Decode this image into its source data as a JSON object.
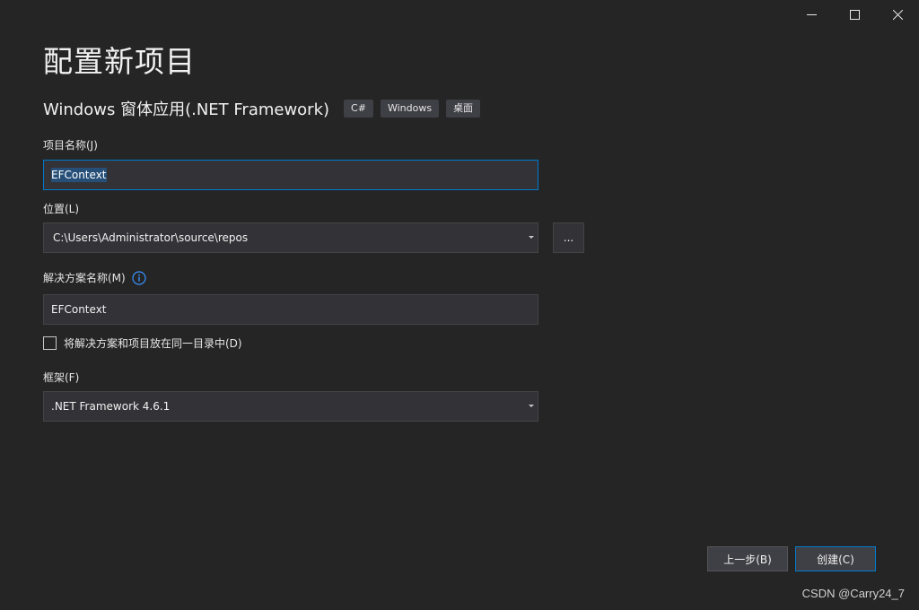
{
  "window": {
    "controls": [
      "minimize",
      "maximize",
      "close"
    ]
  },
  "header": {
    "title": "配置新项目",
    "template_name": "Windows 窗体应用(.NET Framework)",
    "tags": [
      "C#",
      "Windows",
      "桌面"
    ]
  },
  "form": {
    "project_name": {
      "label": "项目名称(J)",
      "value": "EFContext"
    },
    "location": {
      "label": "位置(L)",
      "value": "C:\\Users\\Administrator\\source\\repos",
      "browse_label": "..."
    },
    "solution_name": {
      "label": "解决方案名称(M)",
      "value": "EFContext",
      "info_icon": "info-icon"
    },
    "same_directory": {
      "label": "将解决方案和项目放在同一目录中(D)",
      "checked": false
    },
    "framework": {
      "label": "框架(F)",
      "value": ".NET Framework 4.6.1"
    }
  },
  "footer": {
    "back_label": "上一步(B)",
    "create_label": "创建(C)"
  },
  "watermark": "CSDN @Carry24_7",
  "colors": {
    "background": "#252526",
    "input_background": "#333337",
    "accent": "#007acc",
    "selection": "#264f78"
  }
}
